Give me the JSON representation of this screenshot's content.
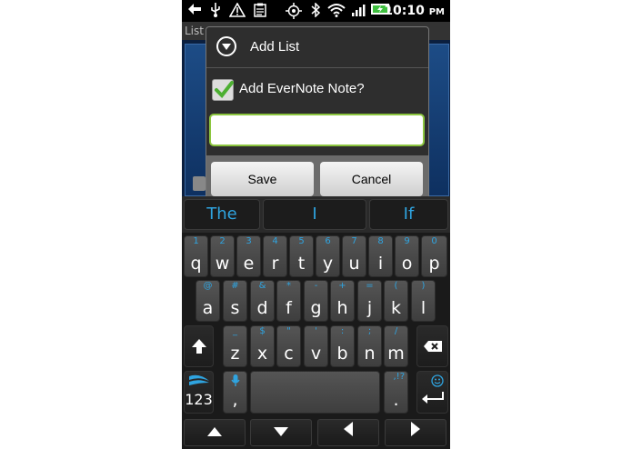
{
  "status_bar": {
    "time": "10:10",
    "ampm": "PM",
    "icons": [
      "back-arrow-icon",
      "usb-icon",
      "warning-icon",
      "clipboard-icon",
      "gps-icon",
      "bluetooth-icon",
      "wifi-icon",
      "signal-icon",
      "battery-icon"
    ]
  },
  "app": {
    "title": "List"
  },
  "dialog": {
    "title": "Add List",
    "checkbox_label": "Add EverNote Note?",
    "checkbox_checked": true,
    "input_value": "",
    "save_label": "Save",
    "cancel_label": "Cancel"
  },
  "keyboard": {
    "suggestions": [
      "The",
      "I",
      "If"
    ],
    "row1": [
      {
        "alt": "1",
        "main": "q"
      },
      {
        "alt": "2",
        "main": "w"
      },
      {
        "alt": "3",
        "main": "e"
      },
      {
        "alt": "4",
        "main": "r"
      },
      {
        "alt": "5",
        "main": "t"
      },
      {
        "alt": "6",
        "main": "y"
      },
      {
        "alt": "7",
        "main": "u"
      },
      {
        "alt": "8",
        "main": "i"
      },
      {
        "alt": "9",
        "main": "o"
      },
      {
        "alt": "0",
        "main": "p"
      }
    ],
    "row2": [
      {
        "alt": "@",
        "main": "a"
      },
      {
        "alt": "#",
        "main": "s"
      },
      {
        "alt": "&",
        "main": "d"
      },
      {
        "alt": "*",
        "main": "f"
      },
      {
        "alt": "-",
        "main": "g"
      },
      {
        "alt": "+",
        "main": "h"
      },
      {
        "alt": "=",
        "main": "j"
      },
      {
        "alt": "(",
        "main": "k"
      },
      {
        "alt": ")",
        "main": "l"
      }
    ],
    "row3": [
      {
        "alt": "_",
        "main": "z"
      },
      {
        "alt": "$",
        "main": "x"
      },
      {
        "alt": "\"",
        "main": "c"
      },
      {
        "alt": "'",
        "main": "v"
      },
      {
        "alt": ":",
        "main": "b"
      },
      {
        "alt": ";",
        "main": "n"
      },
      {
        "alt": "/",
        "main": "m"
      }
    ],
    "numbers_label": "123",
    "comma": ",",
    "period": ".",
    "period_alt": ",!?",
    "accent_color": "#2fa4e0"
  }
}
